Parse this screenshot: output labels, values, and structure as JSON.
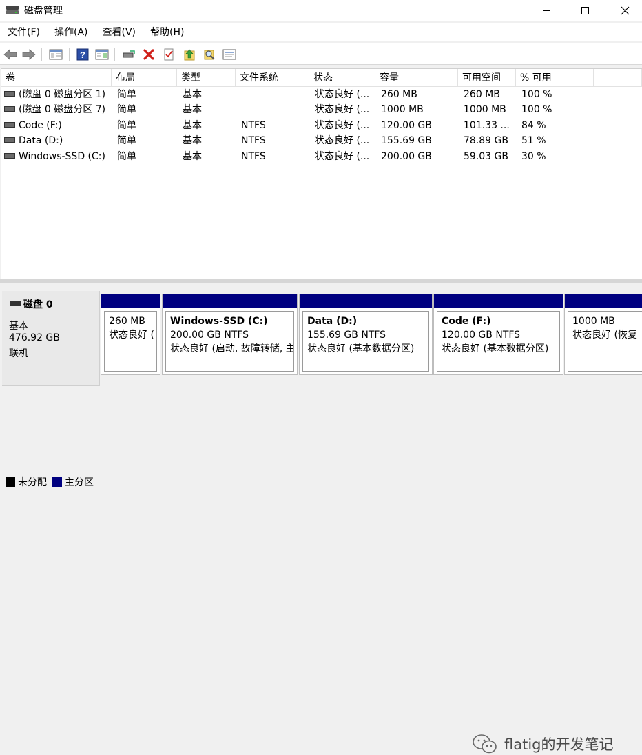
{
  "window": {
    "title": "磁盘管理"
  },
  "menu": [
    "文件(F)",
    "操作(A)",
    "查看(V)",
    "帮助(H)"
  ],
  "toolbar": {
    "icons": [
      "back-icon",
      "forward-icon",
      "console-tree-icon",
      "help-icon",
      "action-pane-icon",
      "connect-disk-icon",
      "delete-icon",
      "check-icon",
      "up-arrow-icon",
      "search-icon",
      "properties-icon"
    ]
  },
  "volume_list": {
    "columns": [
      "卷",
      "布局",
      "类型",
      "文件系统",
      "状态",
      "容量",
      "可用空间",
      "% 可用"
    ],
    "rows": [
      [
        "(磁盘 0 磁盘分区 1)",
        "简单",
        "基本",
        "",
        "状态良好 (...",
        "260 MB",
        "260 MB",
        "100 %"
      ],
      [
        "(磁盘 0 磁盘分区 7)",
        "简单",
        "基本",
        "",
        "状态良好 (...",
        "1000 MB",
        "1000 MB",
        "100 %"
      ],
      [
        "Code (F:)",
        "简单",
        "基本",
        "NTFS",
        "状态良好 (...",
        "120.00 GB",
        "101.33 ...",
        "84 %"
      ],
      [
        "Data (D:)",
        "简单",
        "基本",
        "NTFS",
        "状态良好 (...",
        "155.69 GB",
        "78.89 GB",
        "51 %"
      ],
      [
        "Windows-SSD (C:)",
        "简单",
        "基本",
        "NTFS",
        "状态良好 (...",
        "200.00 GB",
        "59.03 GB",
        "30 %"
      ]
    ]
  },
  "disk": {
    "name": "磁盘 0",
    "type": "基本",
    "size": "476.92 GB",
    "status": "联机",
    "partitions": [
      {
        "name": "",
        "size": "260 MB",
        "status": "状态良好 ("
      },
      {
        "name": "Windows-SSD  (C:)",
        "size": "200.00 GB NTFS",
        "status": "状态良好 (启动, 故障转储, 主"
      },
      {
        "name": "Data  (D:)",
        "size": "155.69 GB NTFS",
        "status": "状态良好 (基本数据分区)"
      },
      {
        "name": "Code  (F:)",
        "size": "120.00 GB NTFS",
        "status": "状态良好 (基本数据分区)"
      },
      {
        "name": "",
        "size": "1000 MB",
        "status": "状态良好 (恢复"
      }
    ]
  },
  "legend": [
    {
      "label": "未分配",
      "color": "#000000"
    },
    {
      "label": "主分区",
      "color": "#000080"
    }
  ],
  "watermark": {
    "text": "flatig的开发笔记"
  }
}
